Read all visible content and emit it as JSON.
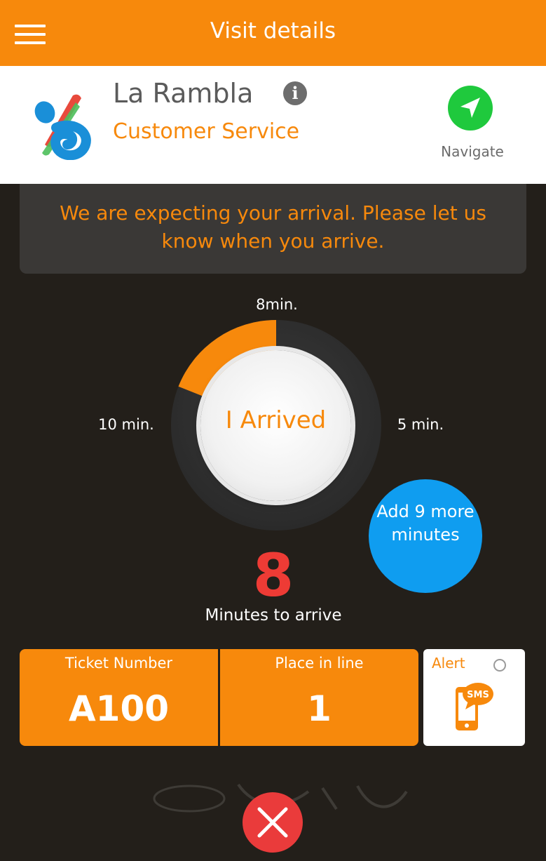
{
  "topbar": {
    "title": "Visit details",
    "menu_icon": "hamburger-menu-icon"
  },
  "header": {
    "place_name": "La Rambla",
    "service": "Customer Service",
    "info_icon": "info-icon",
    "navigate_label": "Navigate",
    "navigate_icon": "navigation-arrow-icon"
  },
  "message": "We are expecting your arrival. Please let us know when you arrive.",
  "dial": {
    "top_label": "8min.",
    "left_label": "10 min.",
    "right_label": "5 min.",
    "progress_fraction": 0.19,
    "button_label": "I Arrived"
  },
  "add_minutes_label": "Add 9 more minutes",
  "minutes_to_arrive": {
    "value": "8",
    "label": "Minutes to arrive"
  },
  "ticket": {
    "number_header": "Ticket Number",
    "number_value": "A100",
    "place_header": "Place in line",
    "place_value": "1"
  },
  "alert": {
    "label": "Alert",
    "checked": false,
    "icon": "sms-phone-icon",
    "icon_text": "SMS"
  },
  "close_icon": "close-x-icon",
  "colors": {
    "accent": "#f7890c",
    "background": "#231f1a",
    "navigate_green": "#1fc93d",
    "add_blue": "#0f9df0",
    "minutes_red": "#ee3b35",
    "close_red": "#ea3b3b"
  }
}
